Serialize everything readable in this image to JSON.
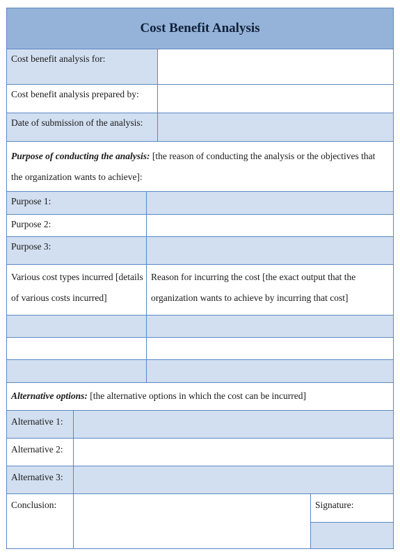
{
  "title": "Cost Benefit Analysis",
  "info_rows": [
    {
      "label": "Cost benefit analysis for:",
      "value": ""
    },
    {
      "label": "Cost benefit analysis prepared by:",
      "value": ""
    },
    {
      "label": "Date of submission of the analysis:",
      "value": ""
    }
  ],
  "purpose_section": {
    "heading": "Purpose of conducting the analysis:",
    "description": " [the reason of conducting the analysis or the objectives that the organization wants to achieve]:"
  },
  "purposes": [
    {
      "label": "Purpose 1:",
      "value": ""
    },
    {
      "label": "Purpose 2:",
      "value": ""
    },
    {
      "label": "Purpose 3:",
      "value": ""
    }
  ],
  "cost_table": {
    "col1_header": "Various cost types incurred [details of various costs incurred]",
    "col2_header": "Reason for incurring the cost [the exact output that the organization wants to achieve by incurring that cost]",
    "rows": [
      {
        "cost": "",
        "reason": ""
      },
      {
        "cost": "",
        "reason": ""
      },
      {
        "cost": "",
        "reason": ""
      }
    ]
  },
  "alternatives_section": {
    "heading": "Alternative options:",
    "description": " [the alternative options in which the cost can be incurred]"
  },
  "alternatives": [
    {
      "label": "Alternative 1:",
      "value": ""
    },
    {
      "label": "Alternative 2:",
      "value": ""
    },
    {
      "label": "Alternative 3:",
      "value": ""
    }
  ],
  "conclusion": {
    "label": "Conclusion:",
    "value": ""
  },
  "signature": {
    "label": "Signature:",
    "value": ""
  }
}
